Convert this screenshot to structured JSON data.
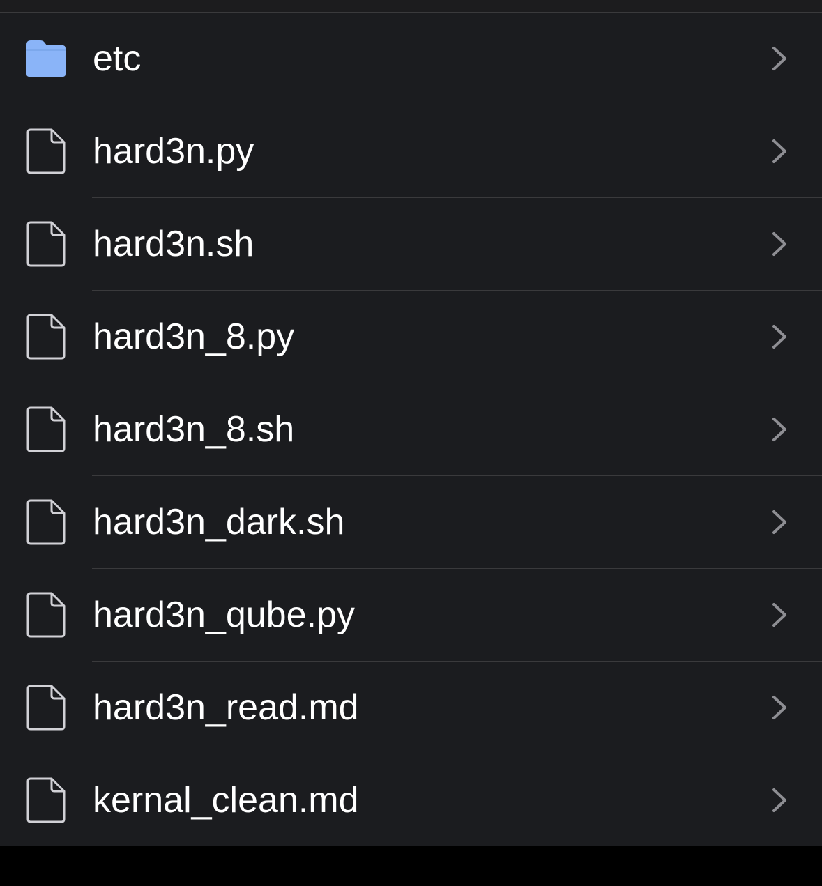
{
  "colors": {
    "background": "#1b1c1f",
    "separator": "#3a3a3c",
    "text": "#ffffff",
    "folder": "#8ab4f8",
    "chevron": "#8e8e93",
    "file_icon": "#d1d1d6"
  },
  "items": [
    {
      "name": "etc",
      "type": "folder",
      "icon": "folder-icon"
    },
    {
      "name": "hard3n.py",
      "type": "file",
      "icon": "document-icon"
    },
    {
      "name": "hard3n.sh",
      "type": "file",
      "icon": "document-icon"
    },
    {
      "name": "hard3n_8.py",
      "type": "file",
      "icon": "document-icon"
    },
    {
      "name": "hard3n_8.sh",
      "type": "file",
      "icon": "document-icon"
    },
    {
      "name": "hard3n_dark.sh",
      "type": "file",
      "icon": "document-icon"
    },
    {
      "name": "hard3n_qube.py",
      "type": "file",
      "icon": "document-icon"
    },
    {
      "name": "hard3n_read.md",
      "type": "file",
      "icon": "document-icon"
    },
    {
      "name": "kernal_clean.md",
      "type": "file",
      "icon": "document-icon"
    }
  ]
}
